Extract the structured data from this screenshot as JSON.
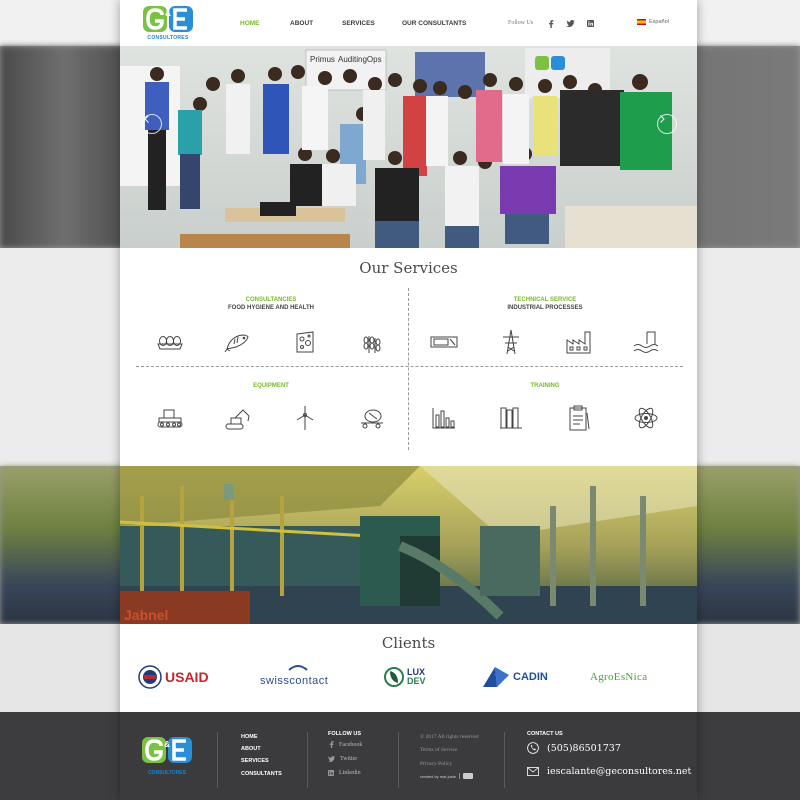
{
  "header": {
    "logo_text": "CONSULTORES",
    "nav": [
      {
        "label": "HOME",
        "active": true
      },
      {
        "label": "ABOUT",
        "active": false
      },
      {
        "label": "SERVICES",
        "active": false
      },
      {
        "label": "OUR CONSULTANTS",
        "active": false
      }
    ],
    "follow_label": "Follow Us",
    "social_icons": [
      "facebook-icon",
      "twitter-icon",
      "linkedin-icon"
    ],
    "language": "Español"
  },
  "hero": {
    "arrows": [
      "chevron-left-icon",
      "chevron-right-icon"
    ]
  },
  "services": {
    "title": "Our Services",
    "groups": [
      {
        "name": "CONSULTANCIES",
        "subtitle": "FOOD HYGIENE AND HEALTH",
        "icons": [
          "eggs-icon",
          "fish-icon",
          "cheese-icon",
          "wheat-icon"
        ]
      },
      {
        "name": "TECHNICAL SERVICE",
        "subtitle": "INDUSTRIAL PROCESSES",
        "icons": [
          "machine-icon",
          "power-tower-icon",
          "factory-icon",
          "water-plant-icon"
        ]
      },
      {
        "name": "EQUIPMENT",
        "subtitle": "",
        "icons": [
          "bulldozer-icon",
          "excavator-icon",
          "wind-turbine-icon",
          "cement-mixer-icon"
        ]
      },
      {
        "name": "TRAINING",
        "subtitle": "",
        "icons": [
          "chart-icon",
          "books-icon",
          "clipboard-icon",
          "atom-icon"
        ]
      }
    ]
  },
  "clients": {
    "title": "Clients",
    "logos": [
      {
        "name": "USAID"
      },
      {
        "name": "swisscontact"
      },
      {
        "name": "LUX",
        "sub": "DEV"
      },
      {
        "name": "CADIN"
      },
      {
        "name": "AgroEsNica"
      }
    ]
  },
  "footer": {
    "logo_text": "CONSULTORES",
    "links": [
      "HOME",
      "ABOUT",
      "SERVICES",
      "CONSULTANTS"
    ],
    "follow": {
      "heading": "FOLLOW US",
      "items": [
        {
          "icon": "facebook-icon",
          "label": "Facebook"
        },
        {
          "icon": "twitter-icon",
          "label": "Twitter"
        },
        {
          "icon": "linkedin-icon",
          "label": "Linkedin"
        }
      ]
    },
    "legal": {
      "copyright": "© 2017 All rights reserved",
      "terms": "Terms of Service",
      "privacy": "Privacy Policy",
      "credit": "created by mat juste"
    },
    "contact": {
      "heading": "CONTACT US",
      "phone": "(505)86501737",
      "email": "iescalante@geconsultores.net"
    }
  },
  "colors": {
    "accent_green": "#77b82a",
    "brand_blue": "#1c86c8",
    "footer_bg": "#3b3b3d"
  }
}
